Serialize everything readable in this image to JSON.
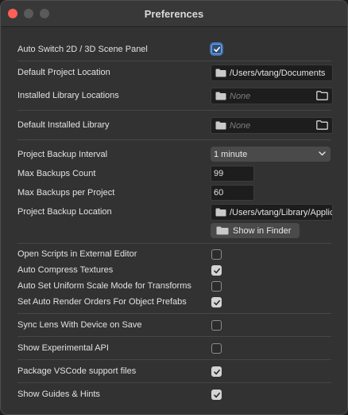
{
  "window": {
    "title": "Preferences"
  },
  "settings": {
    "auto_switch": {
      "label": "Auto Switch 2D / 3D Scene Panel",
      "checked": true
    },
    "default_project_location": {
      "label": "Default Project Location",
      "value": "/Users/vtang/Documents"
    },
    "installed_library_locations": {
      "label": "Installed Library Locations",
      "value": "None"
    },
    "default_installed_library": {
      "label": "Default Installed Library",
      "value": "None"
    },
    "project_backup_interval": {
      "label": "Project Backup Interval",
      "value": "1 minute"
    },
    "max_backups_count": {
      "label": "Max Backups Count",
      "value": "99"
    },
    "max_backups_per_project": {
      "label": "Max Backups per Project",
      "value": "60"
    },
    "project_backup_location": {
      "label": "Project Backup Location",
      "value": "/Users/vtang/Library/Application Support"
    },
    "show_in_finder": {
      "label": "Show in Finder"
    },
    "open_scripts_external": {
      "label": "Open Scripts in External Editor",
      "checked": false
    },
    "auto_compress_textures": {
      "label": "Auto Compress Textures",
      "checked": true
    },
    "auto_uniform_scale": {
      "label": "Auto Set Uniform Scale Mode for Transforms",
      "checked": false
    },
    "auto_render_orders": {
      "label": "Set Auto Render Orders For Object Prefabs",
      "checked": true
    },
    "sync_lens": {
      "label": "Sync Lens With Device on Save",
      "checked": false
    },
    "show_experimental_api": {
      "label": "Show Experimental API",
      "checked": false
    },
    "package_vscode": {
      "label": "Package VSCode support files",
      "checked": true
    },
    "show_guides": {
      "label": "Show Guides & Hints",
      "checked": true
    }
  }
}
